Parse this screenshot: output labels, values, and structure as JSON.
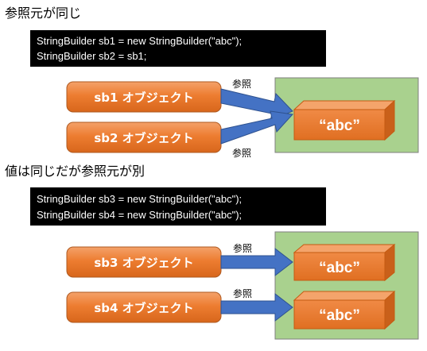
{
  "section1": {
    "heading": "参照元が同じ",
    "code_lines": [
      "StringBuilder sb1 = new StringBuilder(\"abc\");",
      "StringBuilder sb2 = sb1;"
    ],
    "objects": [
      "sb1 オブジェクト",
      "sb2 オブジェクト"
    ],
    "ref_labels": [
      "参照",
      "参照"
    ],
    "values": [
      "“abc”"
    ]
  },
  "section2": {
    "heading": "値は同じだが参照元が別",
    "code_lines": [
      "StringBuilder sb3 = new StringBuilder(\"abc\");",
      "StringBuilder sb4 = new StringBuilder(\"abc\");"
    ],
    "objects": [
      "sb3 オブジェクト",
      "sb4 オブジェクト"
    ],
    "ref_labels": [
      "参照",
      "参照"
    ],
    "values": [
      "“abc”",
      "“abc”"
    ]
  },
  "colors": {
    "object_fill": "#ED7D31",
    "object_stroke": "#AE5A21",
    "arrow_fill": "#4472C4",
    "arrow_stroke": "#2F528F",
    "heap_fill": "#A9D18E",
    "heap_stroke": "#7F7F7F",
    "code_bg": "#000000"
  }
}
